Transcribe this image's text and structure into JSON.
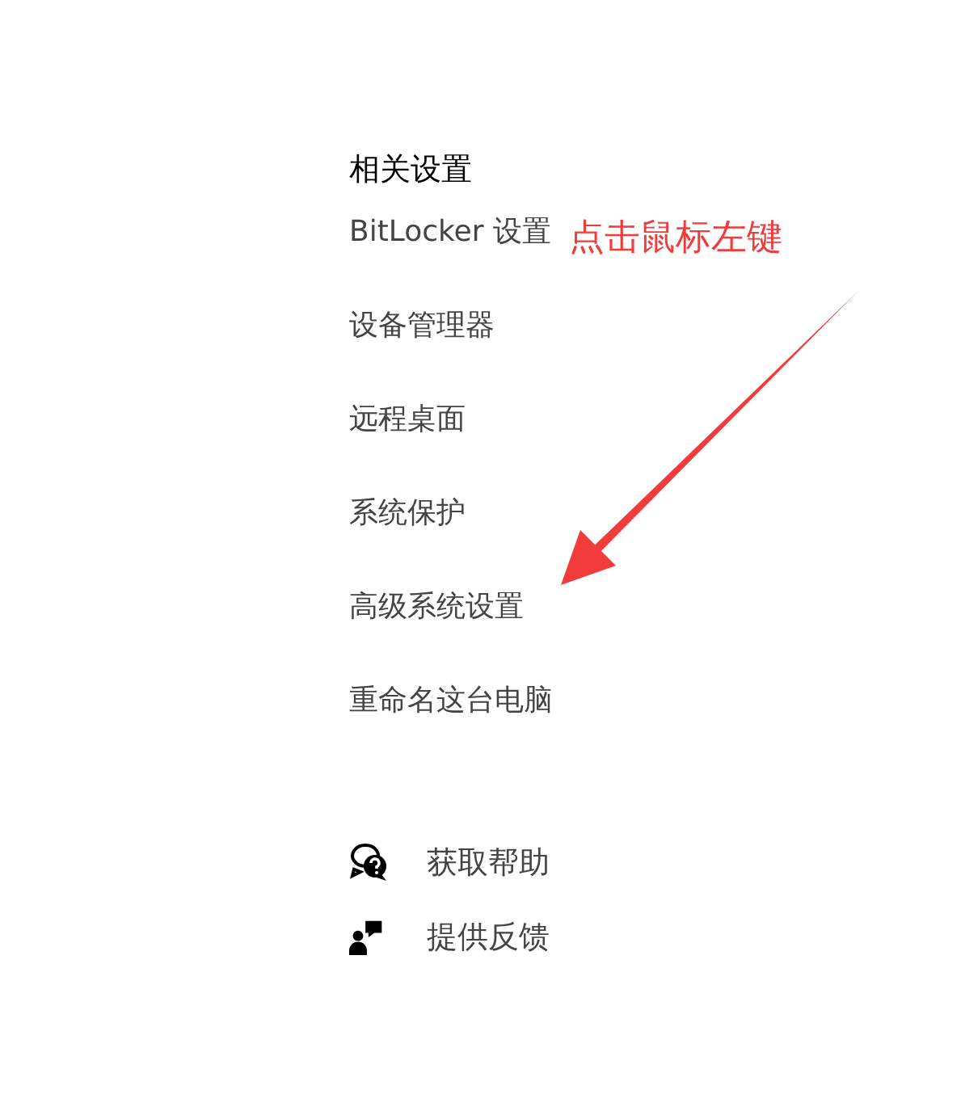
{
  "related_settings": {
    "heading": "相关设置",
    "links": [
      {
        "label": "BitLocker 设置"
      },
      {
        "label": "设备管理器"
      },
      {
        "label": "远程桌面"
      },
      {
        "label": "系统保护"
      },
      {
        "label": "高级系统设置"
      },
      {
        "label": "重命名这台电脑"
      }
    ]
  },
  "support": [
    {
      "kind": "help",
      "label": "获取帮助"
    },
    {
      "kind": "feedback",
      "label": "提供反馈"
    }
  ],
  "annotation": {
    "text": "点击鼠标左键"
  }
}
